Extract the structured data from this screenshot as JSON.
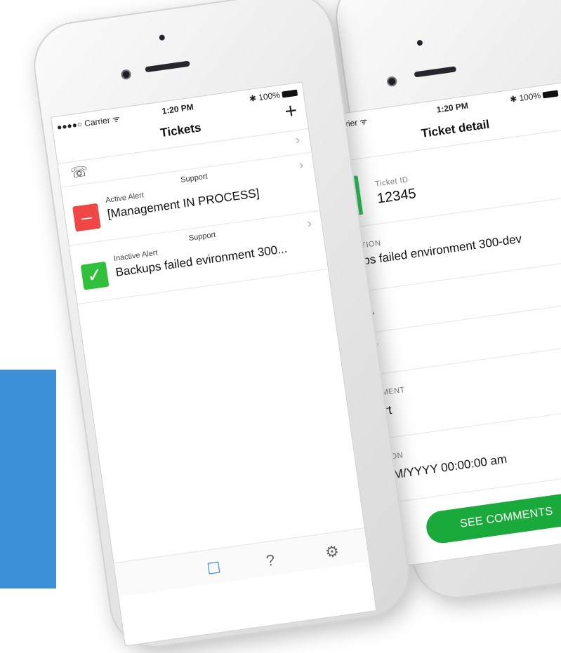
{
  "left_phone": {
    "status": {
      "carrier": "●●●●○ Carrier ᯤ",
      "time": "1:20 PM",
      "battery": "✱ 100%"
    },
    "nav": {
      "title": "Tickets",
      "add_label": "+"
    },
    "call_icon": "phone-icon",
    "tickets": [
      {
        "kind": "Active Alert",
        "queue": "Support",
        "title": "[Management IN PROCESS]",
        "badge": "–",
        "badge_color": "#ef4646"
      },
      {
        "kind": "Inactive Alert",
        "queue": "Support",
        "title": "Backups failed evironment 300...",
        "badge": "✓",
        "badge_color": "#2fbf3b"
      }
    ],
    "tabs": {
      "list": "☐",
      "help": "?",
      "settings": "⚙"
    }
  },
  "right_phone": {
    "status": {
      "carrier": "rier ᯤ",
      "time": "1:20 PM",
      "battery": "✱ 100%"
    },
    "nav": {
      "title": "Ticket detail"
    },
    "ticket_id_label": "Ticket ID",
    "ticket_id": "12345",
    "description_label": "TION",
    "description": "ps failed environment 300-dev",
    "row3_value": "\\",
    "row4_value": "/",
    "assignment_label": "MENT",
    "assignment": "rt",
    "date_label": "ON",
    "date": "M/YYYY 00:00:00 am",
    "button": "SEE COMMENTS"
  },
  "colors": {
    "accent_blue": "#3a8fd6",
    "green": "#1aaa3c",
    "red": "#ef4646"
  }
}
